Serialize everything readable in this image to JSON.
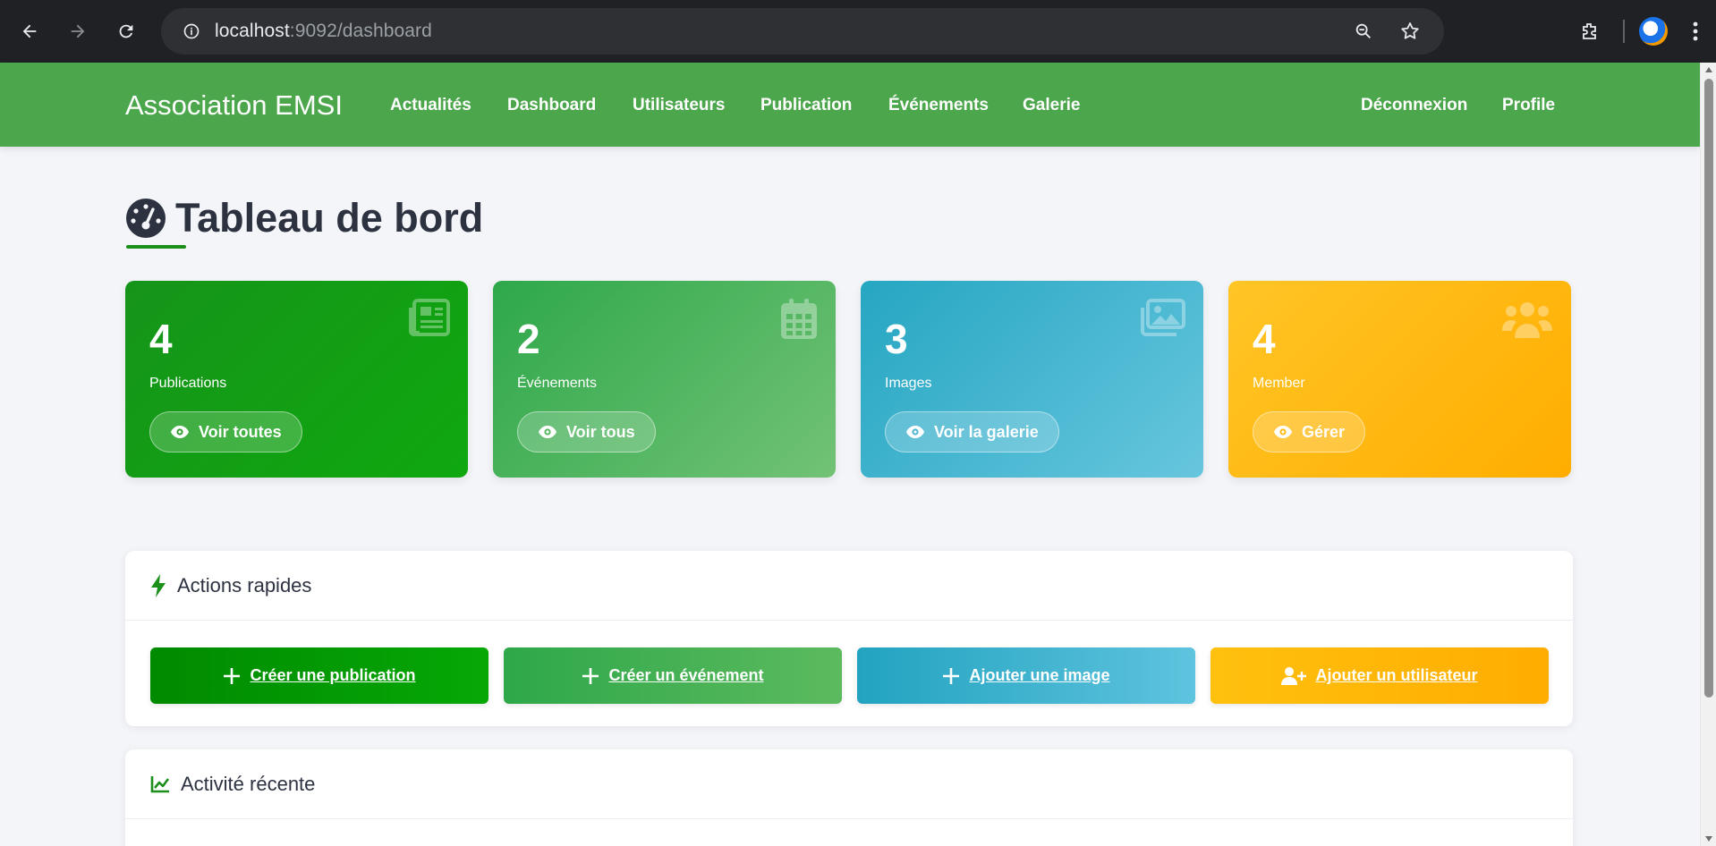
{
  "browser": {
    "url_host": "localhost",
    "url_rest": ":9092/dashboard"
  },
  "nav": {
    "brand": "Association EMSI",
    "links": [
      "Actualités",
      "Dashboard",
      "Utilisateurs",
      "Publication",
      "Événements",
      "Galerie"
    ],
    "right_links": [
      "Déconnexion",
      "Profile"
    ]
  },
  "page": {
    "title": "Tableau de bord",
    "title_icon": "gauge-icon"
  },
  "stats": [
    {
      "value": "4",
      "label": "Publications",
      "button": "Voir toutes",
      "icon": "newspaper-icon",
      "color_start": "#16941a",
      "color_end": "#16a21b"
    },
    {
      "value": "2",
      "label": "Événements",
      "button": "Voir tous",
      "icon": "calendar-icon",
      "color_start": "#2ea84a",
      "color_end": "#6cc070"
    },
    {
      "value": "3",
      "label": "Images",
      "button": "Voir la galerie",
      "icon": "images-icon",
      "color_start": "#26a6c2",
      "color_end": "#63c3dc"
    },
    {
      "value": "4",
      "label": "Member",
      "button": "Gérer",
      "icon": "users-icon",
      "color_start": "#ffc21a",
      "color_end": "#ffb000"
    }
  ],
  "quick_actions": {
    "title": "Actions rapides",
    "icon": "bolt-icon",
    "buttons": [
      {
        "label": "Créer une publication",
        "icon": "plus-icon",
        "color": "#0b9a0b"
      },
      {
        "label": "Créer un événement",
        "icon": "plus-icon",
        "color": "#3aac4f"
      },
      {
        "label": "Ajouter une image",
        "icon": "plus-icon",
        "color": "#2aa7c4"
      },
      {
        "label": "Ajouter un utilisateur",
        "icon": "user-plus-icon",
        "color": "#ffba0a"
      }
    ]
  },
  "recent_activity": {
    "title": "Activité récente",
    "icon": "chart-line-icon"
  },
  "colors": {
    "navbar": "#4ca64c",
    "accent": "#1a8f1a",
    "background": "#f4f5f9"
  }
}
